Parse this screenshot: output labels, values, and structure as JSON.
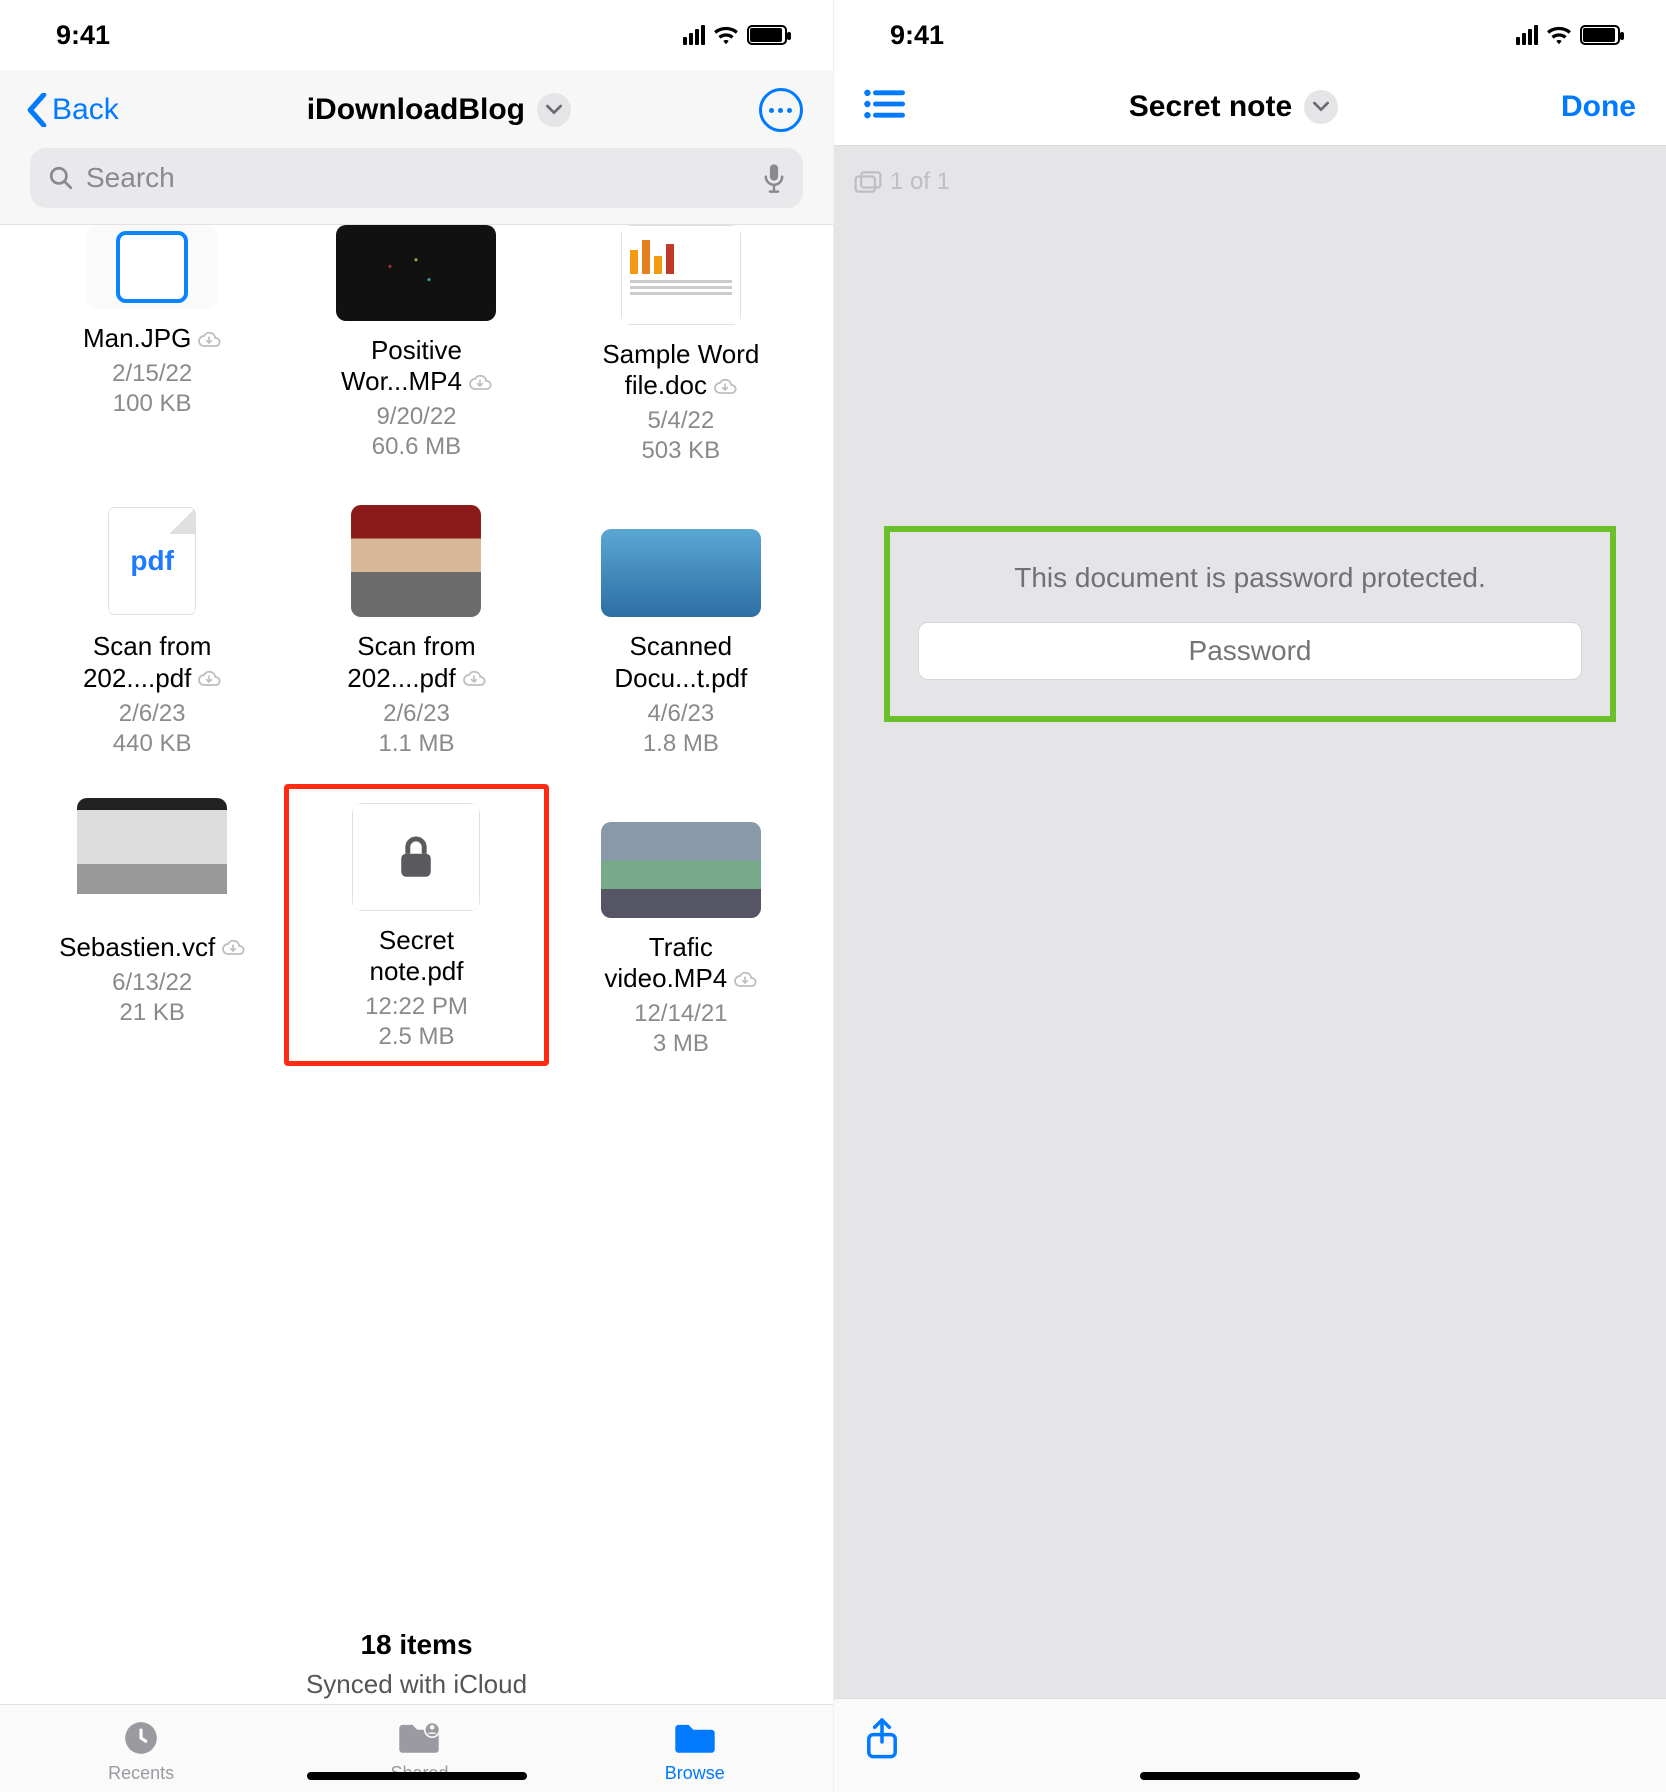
{
  "status": {
    "time": "9:41"
  },
  "left": {
    "back_label": "Back",
    "title": "iDownloadBlog",
    "search_placeholder": "Search",
    "files": [
      {
        "name_l1": "Man.JPG",
        "cloud": true,
        "date": "2/15/22",
        "size": "100 KB"
      },
      {
        "name_l1": "Positive",
        "name_l2": "Wor...MP4",
        "cloud": true,
        "date": "9/20/22",
        "size": "60.6 MB"
      },
      {
        "name_l1": "Sample Word",
        "name_l2": "file.doc",
        "cloud": true,
        "date": "5/4/22",
        "size": "503 KB"
      },
      {
        "name_l1": "Scan from",
        "name_l2": "202....pdf",
        "cloud": true,
        "date": "2/6/23",
        "size": "440 KB"
      },
      {
        "name_l1": "Scan from",
        "name_l2": "202....pdf",
        "cloud": true,
        "date": "2/6/23",
        "size": "1.1 MB"
      },
      {
        "name_l1": "Scanned",
        "name_l2": "Docu...t.pdf",
        "cloud": false,
        "date": "4/6/23",
        "size": "1.8 MB"
      },
      {
        "name_l1": "Sebastien.vcf",
        "cloud": true,
        "date": "6/13/22",
        "size": "21 KB"
      },
      {
        "name_l1": "Secret",
        "name_l2": "note.pdf",
        "cloud": false,
        "date": "12:22 PM",
        "size": "2.5 MB"
      },
      {
        "name_l1": "Trafic",
        "name_l2": "video.MP4",
        "cloud": true,
        "date": "12/14/21",
        "size": "3 MB"
      }
    ],
    "items_count": "18 items",
    "sync_line": "Synced with iCloud",
    "tabs": {
      "recents": "Recents",
      "shared": "Shared",
      "browse": "Browse"
    }
  },
  "right": {
    "title": "Secret note",
    "done": "Done",
    "page_indicator": "1 of 1",
    "protect_msg": "This document is password protected.",
    "password_placeholder": "Password"
  }
}
